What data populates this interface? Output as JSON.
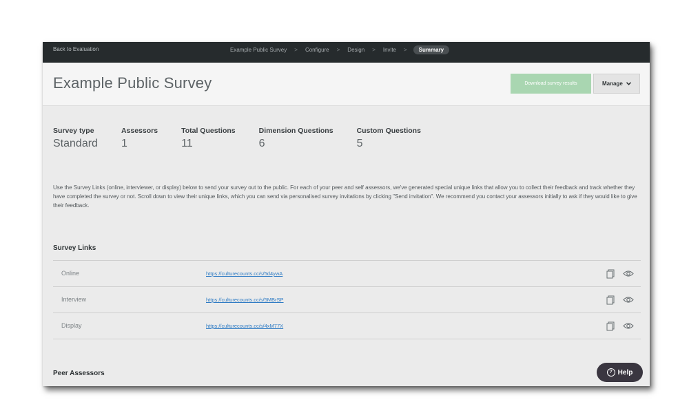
{
  "nav": {
    "back_label": "Back to Evaluation",
    "breadcrumbs": [
      "Example Public Survey",
      "Configure",
      "Design",
      "Invite",
      "Summary"
    ],
    "separator": ">"
  },
  "header": {
    "title": "Example Public Survey",
    "download_label": "Download survey results",
    "manage_label": "Manage",
    "manage_icon": "chevron-down-icon"
  },
  "stats": [
    {
      "label": "Survey type",
      "value": "Standard"
    },
    {
      "label": "Assessors",
      "value": "1"
    },
    {
      "label": "Total Questions",
      "value": "11"
    },
    {
      "label": "Dimension Questions",
      "value": "6"
    },
    {
      "label": "Custom Questions",
      "value": "5"
    }
  ],
  "description": "Use the Survey Links (online, interviewer, or display) below to send your survey out to the public. For each of your peer and self assessors, we've generated special unique links that allow you to collect their feedback and track whether they have completed the survey or not. Scroll down to view their unique links, which you can send via personalised survey invitations by clicking \"Send invitation\". We recommend you contact your assessors initially to ask if they would like to give their feedback.",
  "survey_links": {
    "title": "Survey Links",
    "rows": [
      {
        "label": "Online",
        "url": "https://culturecounts.cc/s/5d4ywA"
      },
      {
        "label": "Interview",
        "url": "https://culturecounts.cc/s/5MBrSP"
      },
      {
        "label": "Display",
        "url": "https://culturecounts.cc/s/4xM77X"
      }
    ]
  },
  "peer_assessors": {
    "title": "Peer Assessors"
  },
  "help": {
    "label": "Help",
    "icon": "question-circle-icon"
  },
  "colors": {
    "nav_bg": "#262b2d",
    "download_bg": "#a9d6b1",
    "link": "#2e7bc4",
    "help_bg": "#3a3640"
  }
}
